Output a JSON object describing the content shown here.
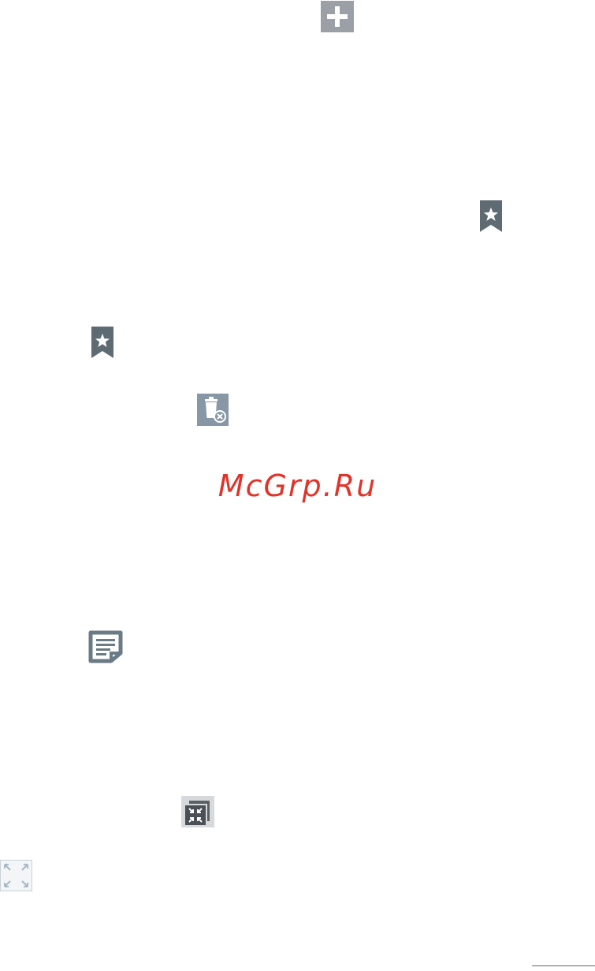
{
  "watermark": {
    "text": "McGrp.Ru",
    "color": "#e0342a"
  },
  "icons": [
    {
      "name": "add-icon",
      "color": "#9aa0a6"
    },
    {
      "name": "bookmark-star-icon",
      "color": "#5f6b73"
    },
    {
      "name": "bookmark-star-icon",
      "color": "#5f6b73"
    },
    {
      "name": "delete-bin-icon",
      "color": "#8797a6"
    },
    {
      "name": "memo-icon",
      "color": "#6b7b86"
    },
    {
      "name": "minimize-window-icon",
      "color": "#5a6166"
    },
    {
      "name": "expand-icon",
      "color": "#a7b7c4"
    }
  ]
}
